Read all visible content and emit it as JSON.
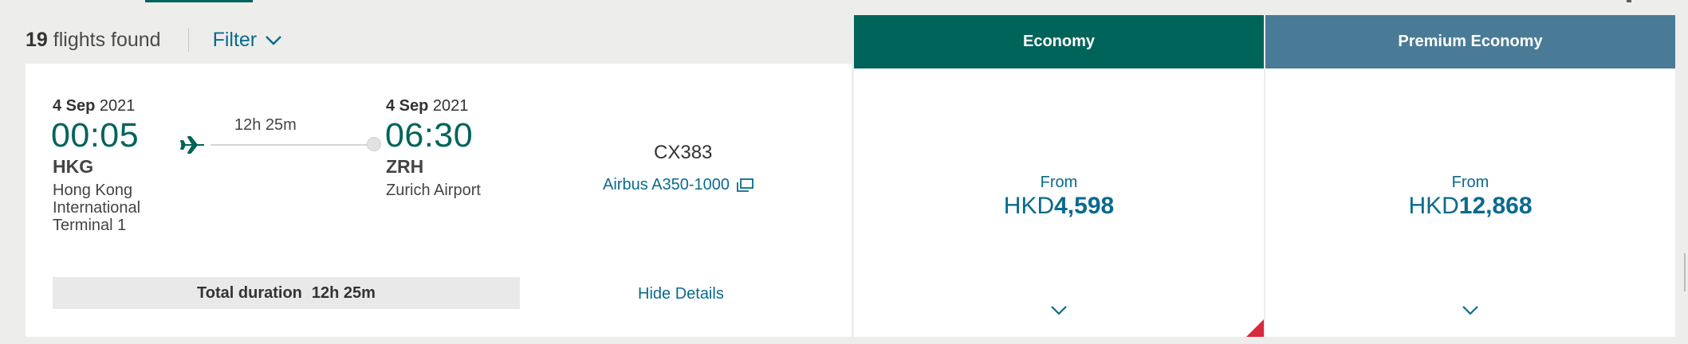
{
  "results": {
    "count": "19",
    "count_suffix": " flights found",
    "filter_label": "Filter"
  },
  "flight": {
    "departure": {
      "day_month": "4 Sep",
      "year": " 2021",
      "time": "00:05",
      "code": "HKG",
      "airport_lines": [
        "Hong Kong",
        "International",
        "Terminal 1"
      ]
    },
    "duration_label": "12h 25m",
    "arrival": {
      "day_month": "4 Sep",
      "year": " 2021",
      "time": "06:30",
      "code": "ZRH",
      "airport": "Zurich Airport"
    },
    "flight_number": "CX383",
    "aircraft": "Airbus A350-1000",
    "total_duration_label": "Total duration",
    "total_duration_value": "12h 25m",
    "hide_details_label": "Hide Details"
  },
  "fares": {
    "economy": {
      "title": "Economy",
      "from_label": "From",
      "currency": "HKD",
      "price": "4,598",
      "header_color": "#00645a"
    },
    "premium_economy": {
      "title": "Premium Economy",
      "from_label": "From",
      "currency": "HKD",
      "price": "12,868",
      "header_color": "#4a7b96"
    }
  },
  "colors": {
    "accent_green": "#00645a",
    "link_blue": "#0a6a8d",
    "flag_red": "#d72a3c"
  },
  "icons": {
    "filter_icon": "chevron-down-icon",
    "plane_icon": "plane-icon",
    "aircraft_link_icon": "external-window-icon",
    "fare_expand_icon": "chevron-down-icon"
  }
}
